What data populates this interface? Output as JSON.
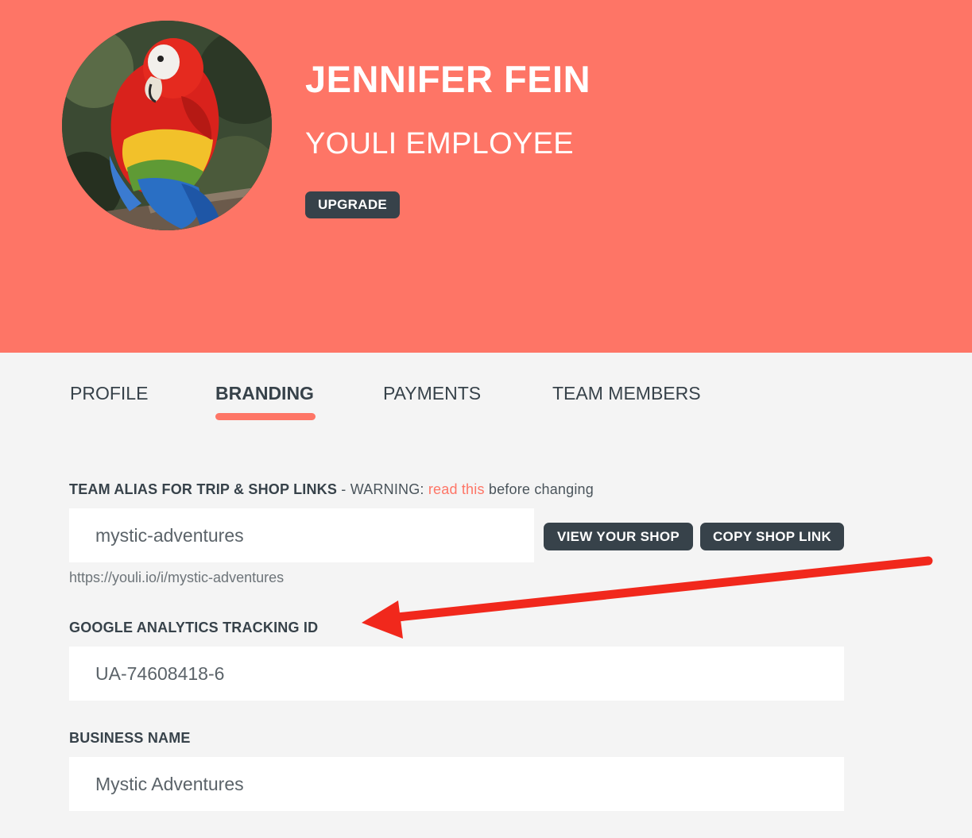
{
  "header": {
    "name": "JENNIFER FEIN",
    "role": "YOULI EMPLOYEE",
    "upgrade_label": "UPGRADE"
  },
  "tabs": [
    {
      "label": "PROFILE",
      "active": false
    },
    {
      "label": "BRANDING",
      "active": true
    },
    {
      "label": "PAYMENTS",
      "active": false
    },
    {
      "label": "TEAM MEMBERS",
      "active": false
    }
  ],
  "branding": {
    "alias": {
      "label": "TEAM ALIAS FOR TRIP & SHOP LINKS",
      "warning_prefix": "- WARNING:",
      "warning_link": "read this",
      "warning_suffix": "before changing",
      "value": "mystic-adventures",
      "hint": "https://youli.io/i/mystic-adventures",
      "view_shop_label": "VIEW YOUR SHOP",
      "copy_link_label": "COPY SHOP LINK"
    },
    "analytics": {
      "label": "GOOGLE ANALYTICS TRACKING ID",
      "value": "UA-74608418-6"
    },
    "business": {
      "label": "BUSINESS NAME",
      "value": "Mystic Adventures"
    }
  },
  "colors": {
    "accent": "#fe7566",
    "dark": "#37424a",
    "background": "#f4f4f4",
    "annotation_arrow": "#f1281c"
  },
  "icons": {
    "avatar": "parrot-photo",
    "annotation": "red-arrow-pointing-left"
  }
}
